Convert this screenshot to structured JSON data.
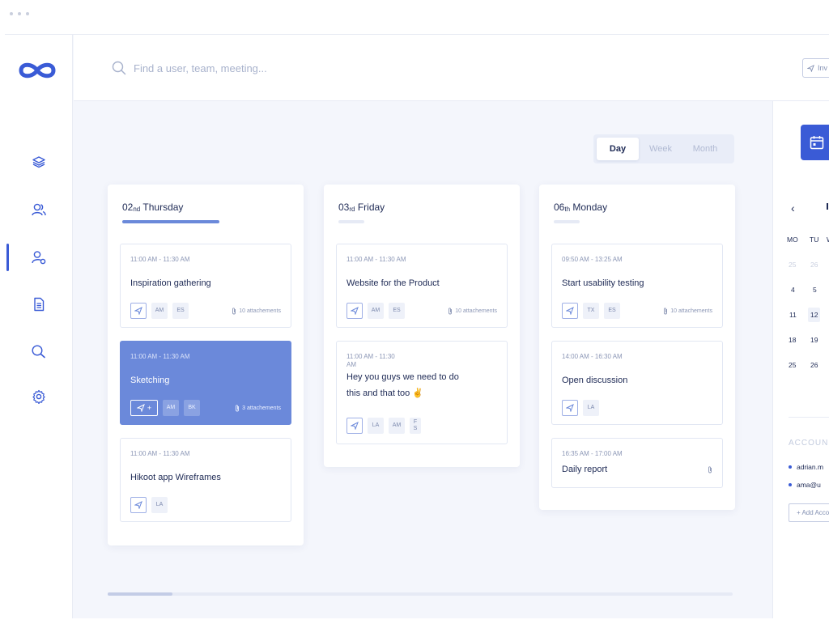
{
  "brand": {
    "logo_icon": "infinity-logo-icon",
    "accent": "#3a5bd6"
  },
  "sidebar": {
    "items": [
      {
        "name": "layers",
        "icon": "layers-icon",
        "active": false
      },
      {
        "name": "team",
        "icon": "users-icon",
        "active": false
      },
      {
        "name": "user-settings",
        "icon": "user-gear-icon",
        "active": true
      },
      {
        "name": "document",
        "icon": "document-icon",
        "active": false
      },
      {
        "name": "search-users",
        "icon": "user-search-icon",
        "active": false
      },
      {
        "name": "settings",
        "icon": "gear-icon",
        "active": false
      }
    ]
  },
  "search": {
    "placeholder": "Find a user, team, meeting..."
  },
  "toolbar": {
    "invite_label": "Inv"
  },
  "view_toggle": {
    "options": [
      "Day",
      "Week",
      "Month"
    ],
    "selected": "Day"
  },
  "columns": [
    {
      "day_num": "02",
      "day_suffix": "nd",
      "day_name": "Thursday",
      "cards": [
        {
          "time": "11:00 AM - 11:30 AM",
          "title": "Inspiration gathering",
          "chips": [
            "AM",
            "ES"
          ],
          "attachments": "10 attachements"
        },
        {
          "time": "11:00 AM - 11:30 AM",
          "title": "Sketching",
          "chips": [
            "AM",
            "BK"
          ],
          "attachments": "3 attachements"
        },
        {
          "time": "11:00 AM - 11:30 AM",
          "title": "Hikoot app Wireframes",
          "chips": [
            "LA"
          ],
          "attachments": ""
        }
      ]
    },
    {
      "day_num": "03",
      "day_suffix": "rd",
      "day_name": "Friday",
      "cards": [
        {
          "time": "11:00 AM - 11:30 AM",
          "title": "Website for the Product",
          "chips": [
            "AM",
            "ES"
          ],
          "attachments": "10 attachements"
        },
        {
          "time": "11:00 AM - 11:30 AM",
          "title": "Hey you guys we need to do this and that too ✌",
          "chips": [
            "LA",
            "AM",
            "F S"
          ],
          "attachments": ""
        }
      ]
    },
    {
      "day_num": "06",
      "day_suffix": "th",
      "day_name": "Monday",
      "cards": [
        {
          "time": "09:50 AM - 13:25 AM",
          "title": "Start usability testing",
          "chips": [
            "TX",
            "ES"
          ],
          "attachments": "10 attachements"
        },
        {
          "time": "14:00 AM - 16:30 AM",
          "title": "Open discussion",
          "chips": [
            "LA"
          ],
          "attachments": ""
        },
        {
          "time": "16:35 AM - 17:00 AM",
          "title": "Daily report",
          "chips": [],
          "attachments": ""
        }
      ]
    }
  ],
  "calendar": {
    "prev_icon": "chevron-left-icon",
    "weekdays": [
      "MO",
      "TU",
      "W"
    ],
    "rows": [
      [
        "25",
        "26"
      ],
      [
        "4",
        "5"
      ],
      [
        "11",
        "12"
      ],
      [
        "18",
        "19"
      ],
      [
        "25",
        "26"
      ]
    ],
    "today": "12"
  },
  "accounts": {
    "heading": "ACCOUN",
    "items": [
      "adrian.m",
      "ama@u"
    ],
    "add_label": "+ Add Acco"
  }
}
